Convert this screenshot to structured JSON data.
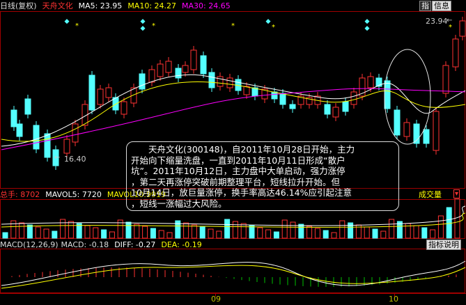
{
  "header": {
    "period_label": "日线(复权)",
    "stock_name": "天舟文化",
    "ma5": "MA5: 23.95",
    "ma10": "MA10: 24.27",
    "ma30": "MA30: 24.65",
    "btn_zoom": "指",
    "btn_info": "信息",
    "price_high": "23.94",
    "price_low": "16.40"
  },
  "volume": {
    "total": "总手: 8702",
    "mavol5": "MAVOL5: 7720",
    "mavol10": "MAVOL10:9919",
    "button": "成交量"
  },
  "macd": {
    "label": "MACD(12,26,9)",
    "macd": "MACD: -0.18",
    "diff": "DIFF: -0.27",
    "dea": "DEA: -0.19",
    "button": "指标说明"
  },
  "axis": {
    "month1": "09",
    "month2": "10"
  },
  "callout": {
    "lines": [
      "　　天舟文化(300148)，自2011年10月28日开始，主力",
      "开始向下缩量洗盘，一直到2011年10月11日形成“散户",
      "坑”。2011年10月12日，主力盘中大单启动，强力涨停",
      "，第二天再涨停突破前期整理平台，短线拉升开始。但",
      "10月14日，放巨量涨停，换手率高达46.14%应引起注意",
      "，短线一涨幅过大风险。"
    ]
  },
  "colors": {
    "up": "#ff3232",
    "down": "#54ffff",
    "ma5": "#ffffff",
    "ma10": "#ffff00",
    "ma30": "#ff00ff",
    "frame": "#a00000"
  }
}
